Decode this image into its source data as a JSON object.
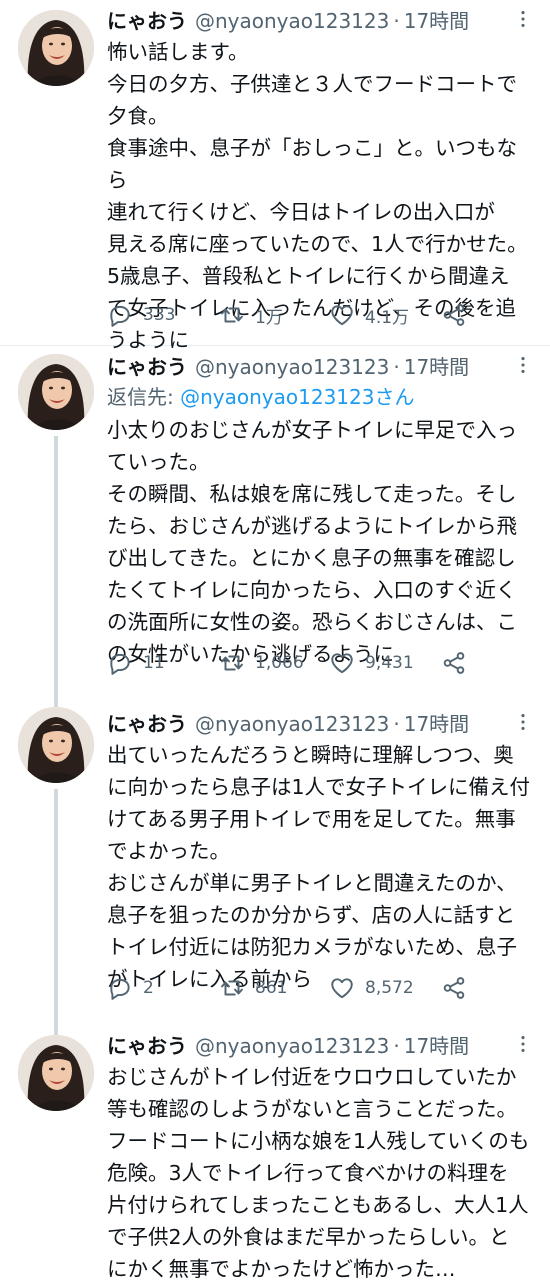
{
  "tweets": [
    {
      "name": "にゃおう",
      "handle": "@nyaonyao123123",
      "sep": "·",
      "time": "17時間",
      "reply_prefix": "",
      "reply_handle": "",
      "lines": [
        "怖い話します。",
        "今日の夕方、子供達と３人でフードコートで",
        "夕食。",
        "食事途中、息子が「おしっこ」と。いつもなら",
        "連れて行くけど、今日はトイレの出入口が",
        "見える席に座っていたので、1人で行かせた。",
        "5歳息子、普段私とトイレに行くから間違え",
        "て女子トイレに入ったんだけど、その後を追",
        "うように"
      ],
      "replies": "333",
      "retweets": "1万",
      "likes": "4.1万"
    },
    {
      "name": "にゃおう",
      "handle": "@nyaonyao123123",
      "sep": "·",
      "time": "17時間",
      "reply_prefix": "返信先: ",
      "reply_handle": "@nyaonyao123123さん",
      "lines": [
        "小太りのおじさんが女子トイレに早足で入っ",
        "ていった。",
        "その瞬間、私は娘を席に残して走った。そし",
        "たら、おじさんが逃げるようにトイレから飛",
        "び出してきた。とにかく息子の無事を確認し",
        "たくてトイレに向かったら、入口のすぐ近く",
        "の洗面所に女性の姿。恐らくおじさんは、こ",
        "の女性がいたから逃げるように"
      ],
      "replies": "11",
      "retweets": "1,066",
      "likes": "9,431"
    },
    {
      "name": "にゃおう",
      "handle": "@nyaonyao123123",
      "sep": "·",
      "time": "17時間",
      "reply_prefix": "",
      "reply_handle": "",
      "lines": [
        "出ていったんだろうと瞬時に理解しつつ、奥",
        "に向かったら息子は1人で女子トイレに備え付",
        "けてある男子用トイレで用を足してた。無事",
        "でよかった。",
        "おじさんが単に男子トイレと間違えたのか、",
        "息子を狙ったのか分からず、店の人に話すと",
        "トイレ付近には防犯カメラがないため、息子",
        "がトイレに入る前から"
      ],
      "replies": "2",
      "retweets": "861",
      "likes": "8,572"
    },
    {
      "name": "にゃおう",
      "handle": "@nyaonyao123123",
      "sep": "·",
      "time": "17時間",
      "reply_prefix": "",
      "reply_handle": "",
      "lines": [
        "おじさんがトイレ付近をウロウロしていたか",
        "等も確認のしようがないと言うことだった。",
        "フードコートに小柄な娘を1人残していくのも",
        "危険。3人でトイレ行って食べかけの料理を",
        "片付けられてしまったこともあるし、大人1人",
        "で子供2人の外食はまだ早かったらしい。と",
        "にかく無事でよかったけど怖かった…"
      ],
      "replies": "",
      "retweets": "",
      "likes": ""
    }
  ],
  "colors": {
    "text": "#0f1419",
    "muted": "#536471",
    "link": "#1d9bf0",
    "divider": "#e6ecf0",
    "thread": "#cfd9de"
  },
  "icons": {
    "reply": "reply-icon",
    "retweet": "retweet-icon",
    "like": "heart-icon",
    "share": "share-icon",
    "more": "caret-icon"
  }
}
